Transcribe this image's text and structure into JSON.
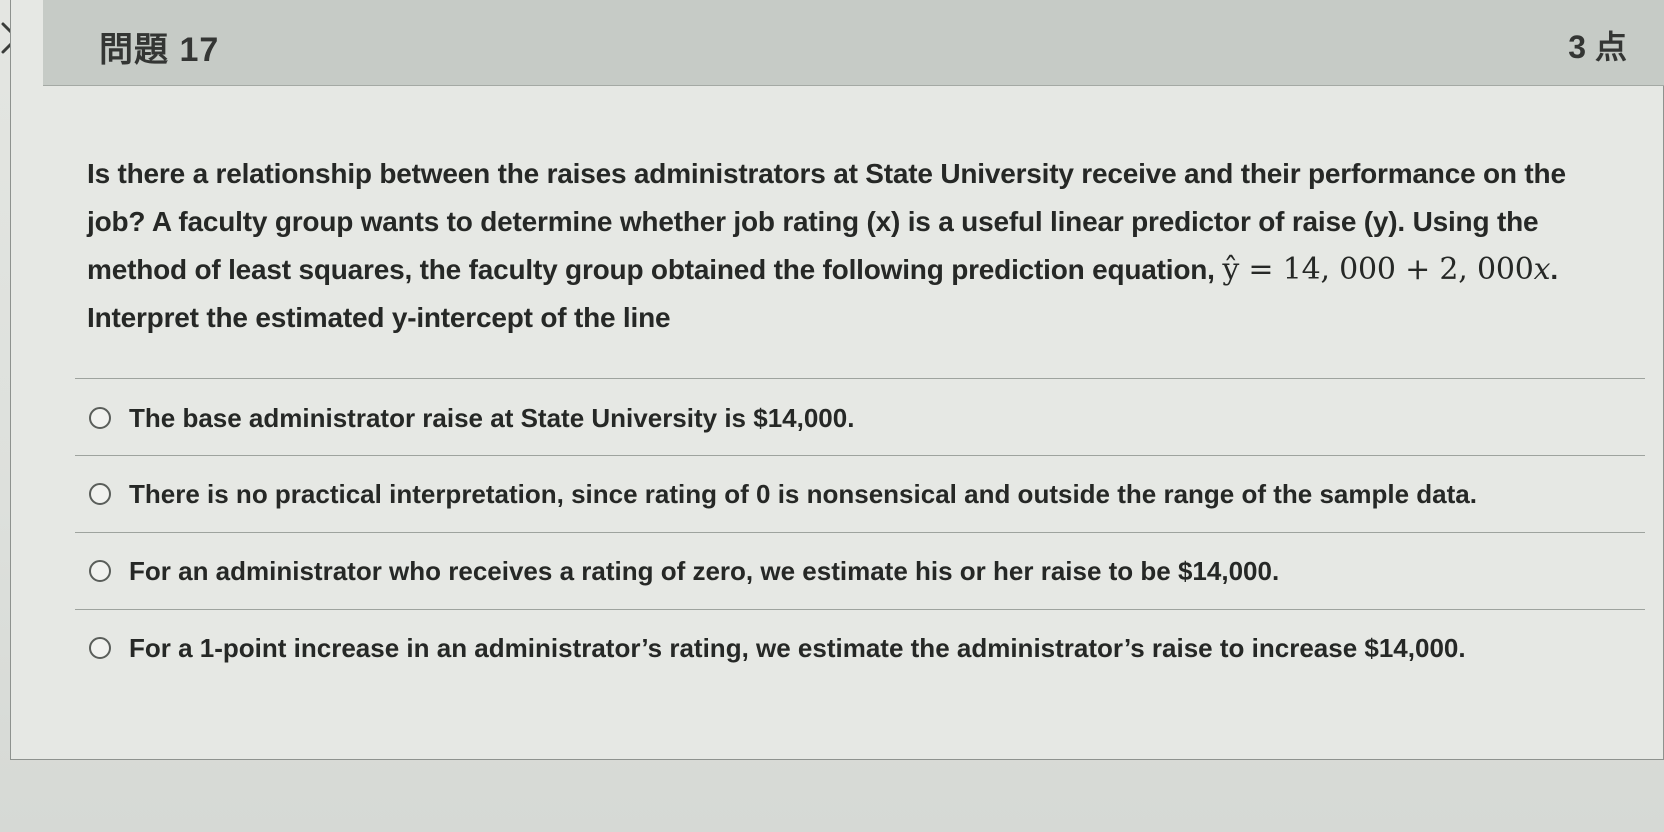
{
  "question": {
    "title": "問題 17",
    "points": "3 点",
    "prompt_part1": "Is there a relationship between the raises administrators at State University receive and their performance on the job? A faculty group wants to determine whether job rating (x) is a useful linear predictor of raise (y). Using the method of least squares, the faculty group obtained the following prediction equation, ",
    "equation_yhat": "ŷ",
    "equation_rest": " = 14, 000 + 2, 000",
    "equation_var": "x",
    "prompt_part2": ". Interpret the estimated y-intercept of the line"
  },
  "options": [
    {
      "label": "The base administrator raise at State University is $14,000."
    },
    {
      "label": "There is no practical interpretation, since rating of 0 is nonsensical and outside the range of the sample data."
    },
    {
      "label": "For an administrator who receives a rating of zero, we estimate his or her raise to be $14,000."
    },
    {
      "label": "For a 1-point increase in an administrator’s rating, we estimate the administrator’s raise to increase $14,000."
    }
  ]
}
